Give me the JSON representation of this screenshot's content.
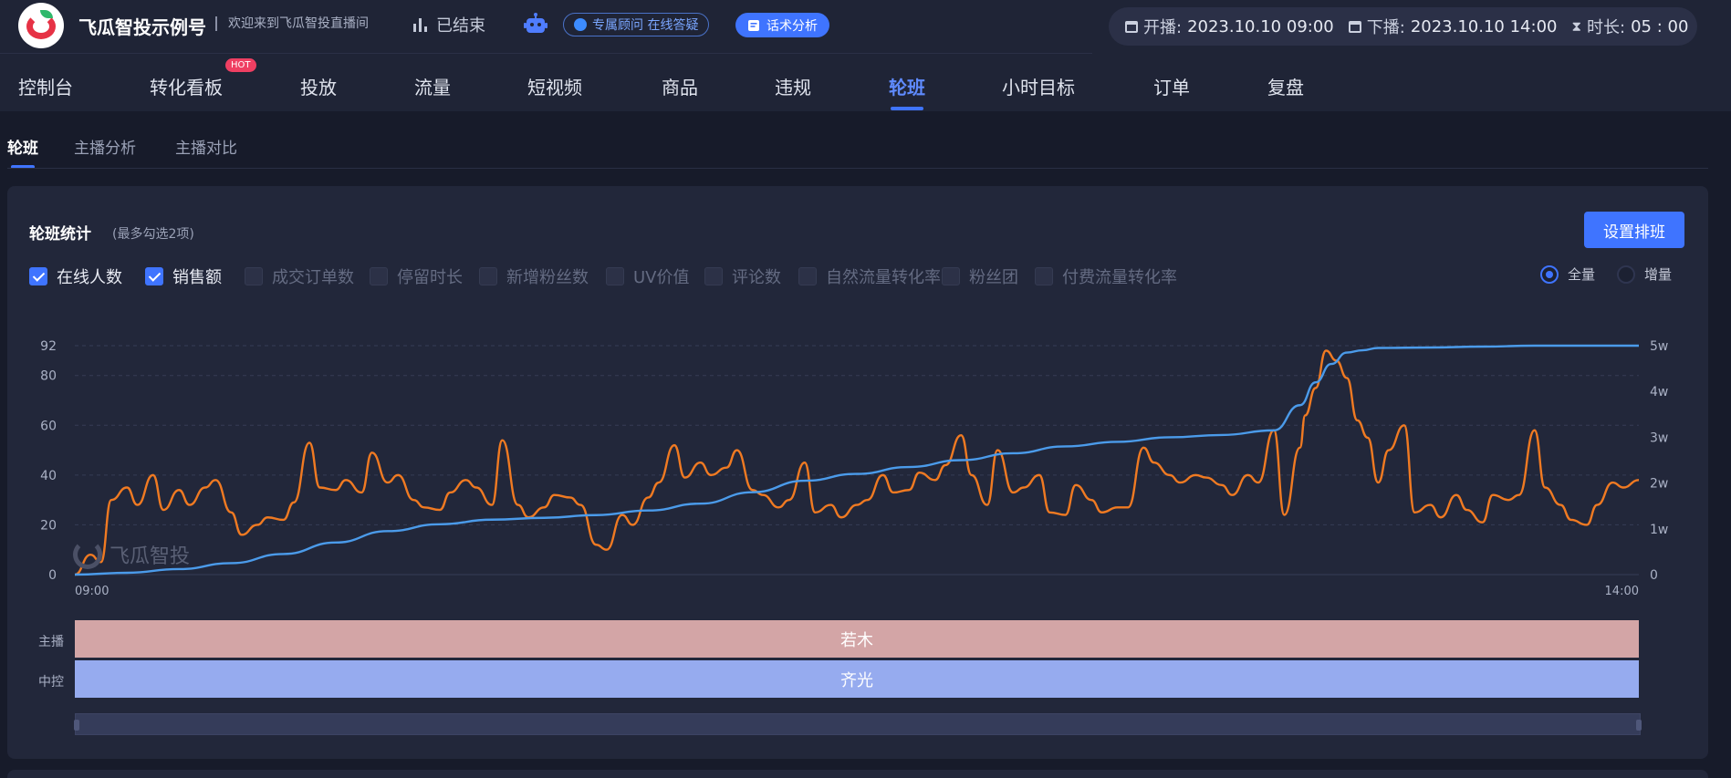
{
  "header": {
    "brand": "飞瓜智投示例号",
    "welcome": "欢迎来到飞瓜智投直播间",
    "live_status": "已结束",
    "advisor_badge": "专属顾问 在线答疑",
    "script_analysis_button": "话术分析",
    "start_label": "开播:",
    "start_time": "2023.10.10 09:00",
    "end_label": "下播:",
    "end_time": "2023.10.10 14:00",
    "duration_label": "时长:",
    "duration": "05 : 00"
  },
  "nav": {
    "items": [
      "控制台",
      "转化看板",
      "投放",
      "流量",
      "短视频",
      "商品",
      "违规",
      "轮班",
      "小时目标",
      "订单",
      "复盘"
    ],
    "active_index": 7,
    "hot_badge": "HOT"
  },
  "subtabs": {
    "items": [
      "轮班",
      "主播分析",
      "主播对比"
    ],
    "active_index": 0
  },
  "card": {
    "title": "轮班统计",
    "hint": "(最多勾选2项)",
    "schedule_button": "设置排班",
    "metrics": [
      {
        "label": "在线人数",
        "checked": true
      },
      {
        "label": "销售额",
        "checked": true
      },
      {
        "label": "成交订单数",
        "checked": false
      },
      {
        "label": "停留时长",
        "checked": false
      },
      {
        "label": "新增粉丝数",
        "checked": false
      },
      {
        "label": "UV价值",
        "checked": false
      },
      {
        "label": "评论数",
        "checked": false
      },
      {
        "label": "自然流量转化率",
        "checked": false
      },
      {
        "label": "粉丝团",
        "checked": false
      },
      {
        "label": "付费流量转化率",
        "checked": false
      }
    ],
    "mode_options": [
      {
        "label": "全量",
        "checked": true
      },
      {
        "label": "增量",
        "checked": false
      }
    ],
    "watermark": "飞瓜智投",
    "lanes": {
      "host_label": "主播",
      "host_name": "若木",
      "host_color": "#d3a5a6",
      "control_label": "中控",
      "control_name": "齐光",
      "control_color": "#96abef"
    }
  },
  "colors": {
    "accent": "#3f74ff",
    "online_line": "#f07a22",
    "sales_line": "#4b9bea"
  },
  "chart_data": {
    "type": "line",
    "x_start_label": "09:00",
    "x_end_label": "14:00",
    "x_range_minutes": [
      0,
      300
    ],
    "left_axis": {
      "ticks": [
        0,
        20,
        40,
        60,
        80,
        92
      ],
      "range": [
        0,
        92
      ]
    },
    "right_axis": {
      "ticks": [
        "0",
        "1w",
        "2w",
        "3w",
        "4w",
        "5w"
      ],
      "range": [
        0,
        50000
      ]
    },
    "grid": true,
    "series": [
      {
        "axis": "left",
        "color": "#f07a22",
        "x": [
          0,
          3,
          5,
          7,
          10,
          12,
          15,
          17,
          20,
          22,
          25,
          27,
          30,
          32,
          35,
          37,
          40,
          42,
          45,
          47,
          50,
          52,
          55,
          57,
          60,
          62,
          65,
          67,
          70,
          72,
          75,
          77,
          80,
          82,
          85,
          87,
          90,
          92,
          95,
          97,
          100,
          102,
          105,
          107,
          110,
          112,
          115,
          117,
          120,
          122,
          125,
          127,
          130,
          132,
          135,
          137,
          140,
          142,
          145,
          147,
          150,
          152,
          155,
          157,
          160,
          162,
          165,
          167,
          170,
          172,
          175,
          177,
          180,
          182,
          185,
          187,
          190,
          192,
          195,
          197,
          200,
          202,
          205,
          207,
          210,
          212,
          215,
          217,
          220,
          222,
          225,
          227,
          230,
          232,
          235,
          236,
          238,
          240,
          242,
          244,
          246,
          248,
          250,
          252,
          255,
          257,
          260,
          262,
          265,
          267,
          270,
          272,
          275,
          277,
          280,
          282,
          285,
          287,
          290,
          292,
          295,
          297,
          300
        ],
        "values": [
          0,
          8,
          5,
          30,
          35,
          28,
          40,
          26,
          34,
          28,
          35,
          38,
          25,
          16,
          20,
          23,
          22,
          29,
          53,
          35,
          34,
          38,
          33,
          49,
          37,
          40,
          30,
          27,
          26,
          33,
          38,
          35,
          28,
          54,
          28,
          23,
          27,
          32,
          31,
          28,
          12,
          10,
          24,
          20,
          31,
          37,
          52,
          39,
          45,
          40,
          43,
          50,
          34,
          32,
          27,
          30,
          45,
          25,
          28,
          23,
          28,
          30,
          40,
          33,
          34,
          41,
          38,
          44,
          56,
          40,
          28,
          50,
          33,
          35,
          40,
          25,
          24,
          36,
          30,
          25,
          27,
          27,
          51,
          45,
          40,
          37,
          40,
          39,
          36,
          32,
          40,
          37,
          58,
          24,
          51,
          64,
          75,
          90,
          86,
          79,
          62,
          55,
          37,
          50,
          60,
          25,
          28,
          23,
          32,
          26,
          21,
          32,
          30,
          32,
          58,
          35,
          28,
          22,
          20,
          28,
          37,
          35,
          38
        ]
      },
      {
        "axis": "right",
        "color": "#4b9bea",
        "x": [
          0,
          10,
          20,
          30,
          40,
          50,
          60,
          70,
          80,
          90,
          100,
          110,
          120,
          130,
          140,
          150,
          160,
          170,
          180,
          190,
          200,
          210,
          220,
          230,
          235,
          238,
          241,
          244,
          247,
          250,
          260,
          270,
          280,
          290,
          300
        ],
        "values": [
          0,
          400,
          1200,
          2500,
          4500,
          7000,
          9500,
          11000,
          12000,
          12400,
          13000,
          14000,
          15500,
          18000,
          20500,
          22000,
          23500,
          25000,
          26500,
          28000,
          29000,
          30000,
          30500,
          31500,
          37000,
          42000,
          46000,
          48500,
          49000,
          49500,
          49600,
          49800,
          50000,
          50000,
          50000
        ]
      }
    ]
  }
}
